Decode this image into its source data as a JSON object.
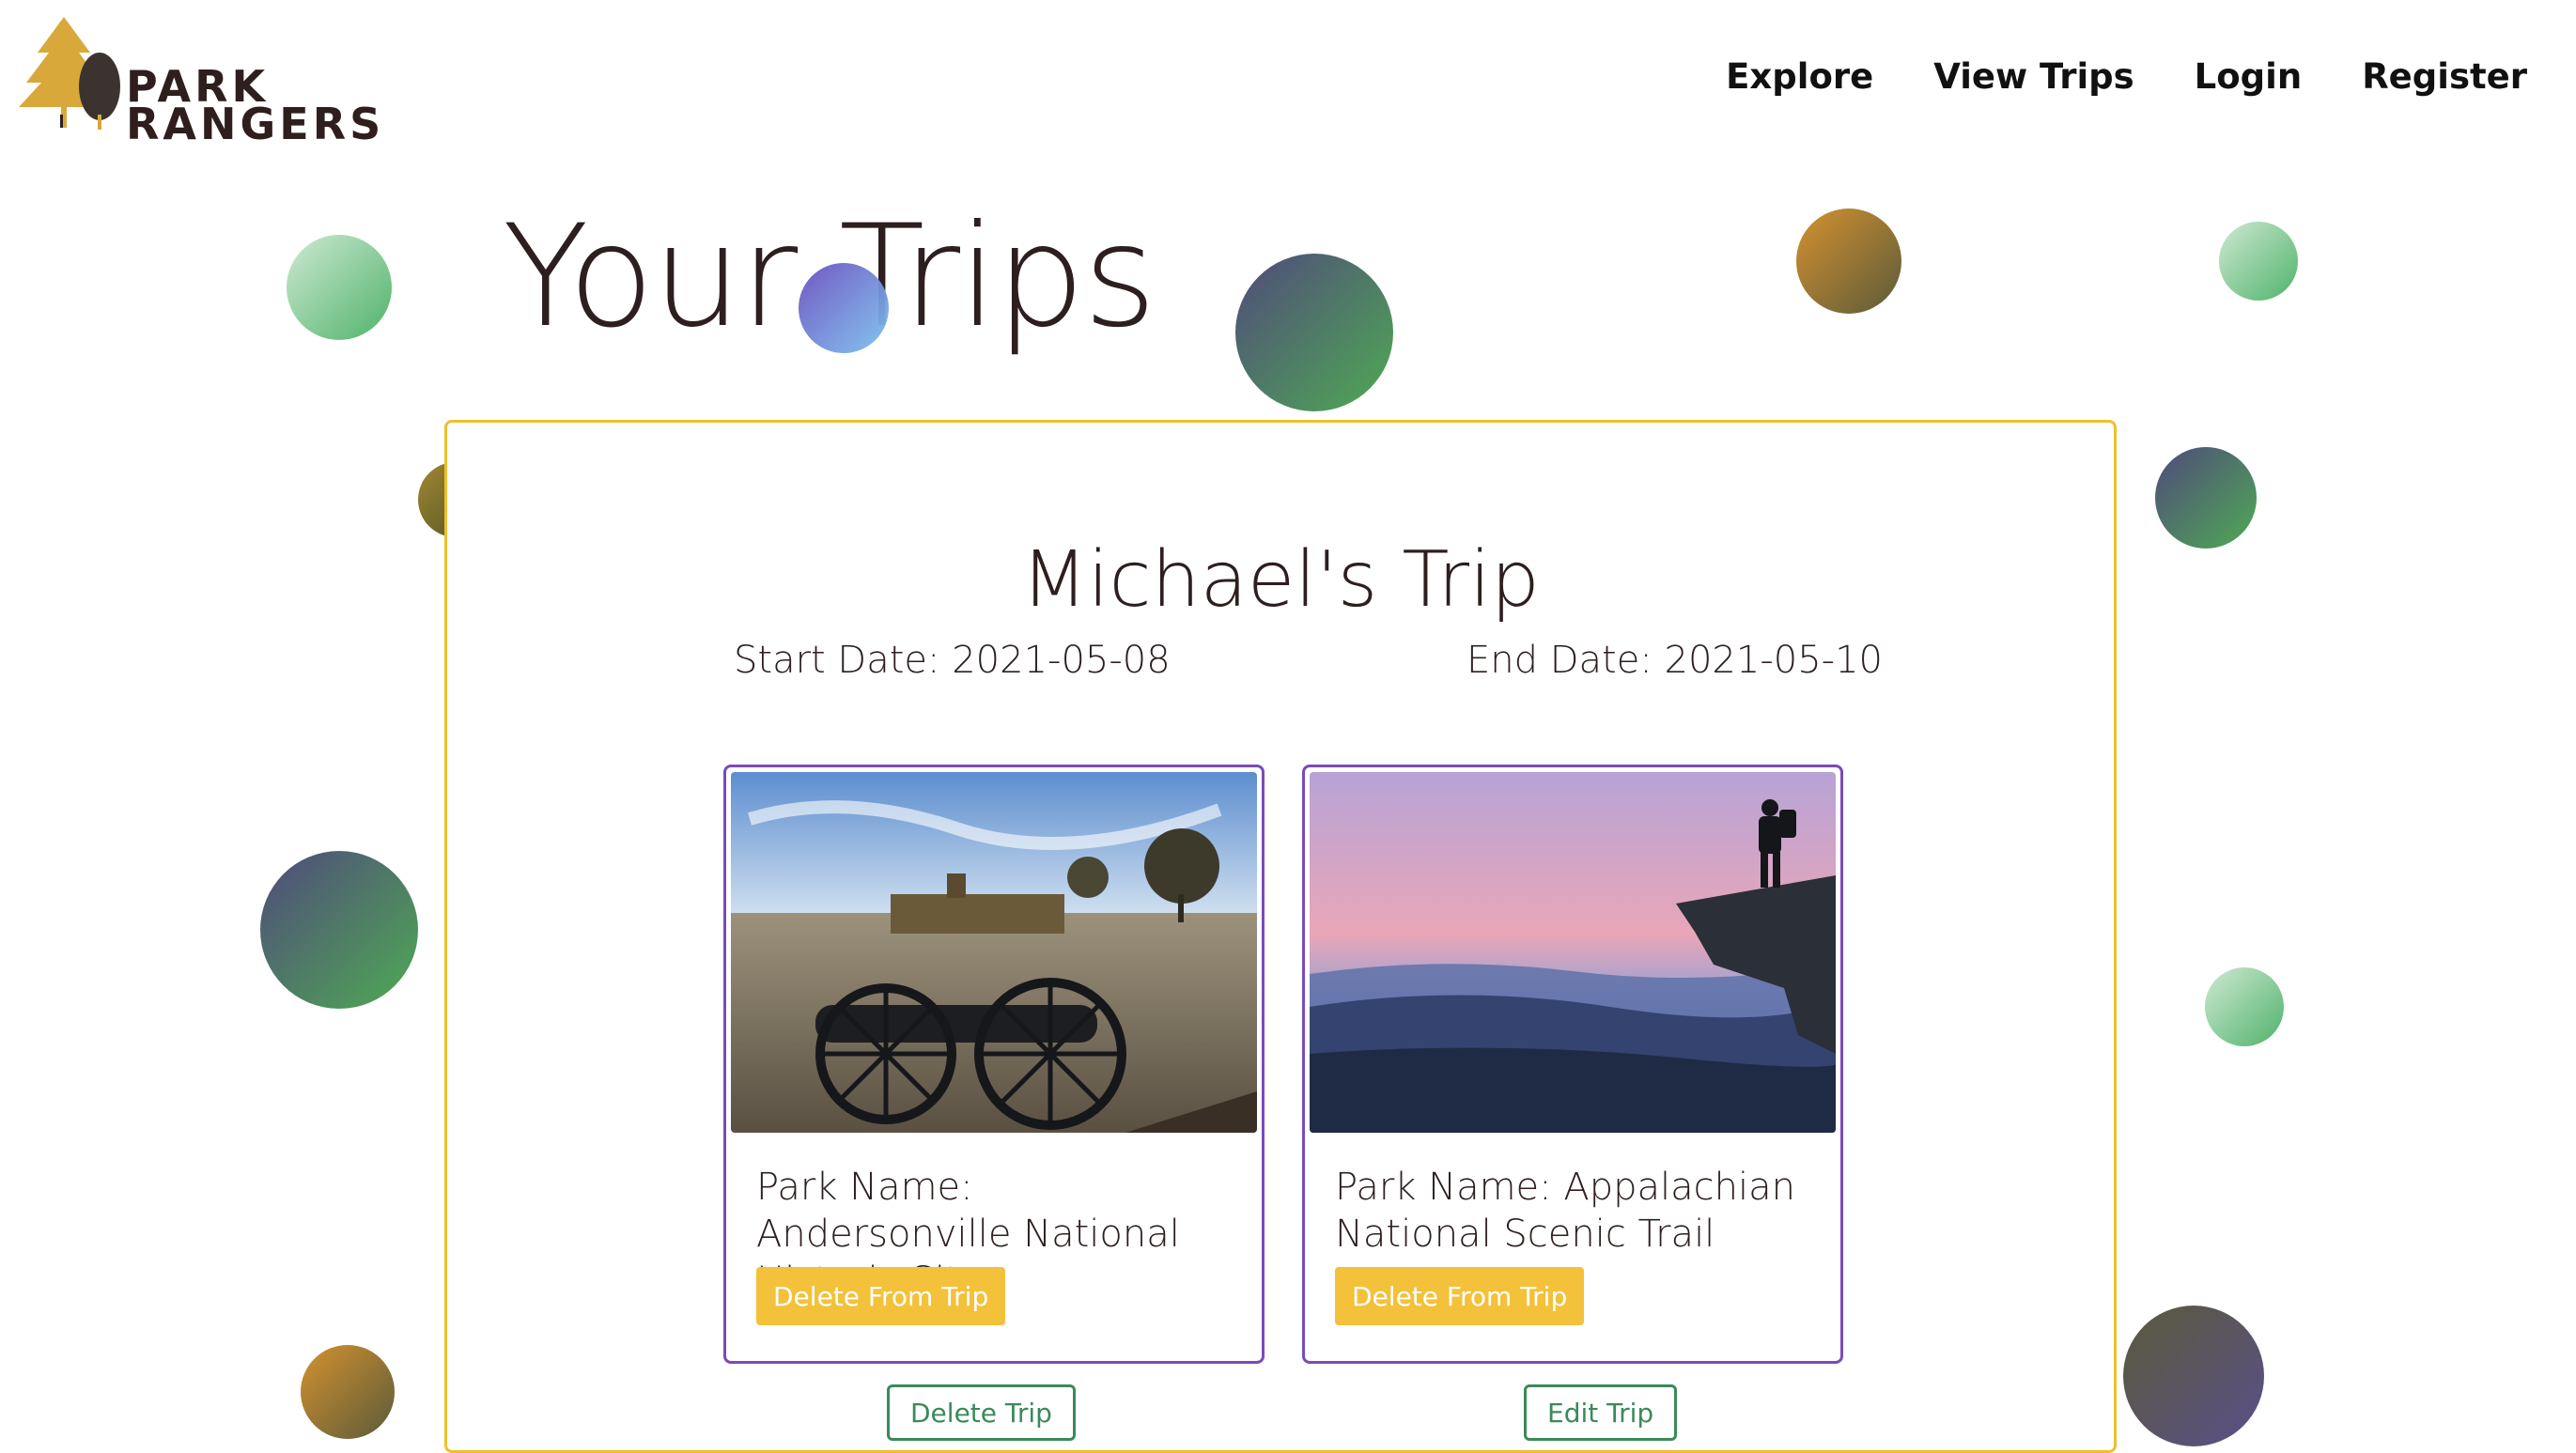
{
  "brand": {
    "line1": "PARK",
    "line2": "RANGERS"
  },
  "nav": [
    "Explore",
    "View Trips",
    "Login",
    "Register"
  ],
  "page_title": "Your Trips",
  "trip": {
    "name": "Michael's Trip",
    "start_date": "Start Date: 2021-05-08",
    "end_date": "End Date: 2021-05-10",
    "parks": [
      {
        "name": "Park Name: Andersonville National Historic Site",
        "photo": "cannon-fort-photo",
        "button": "Delete From Trip"
      },
      {
        "name": "Park Name: Appalachian National Scenic Trail",
        "photo": "hiker-ridge-sunset-photo",
        "button": "Delete From Trip"
      }
    ],
    "footer_buttons": [
      "Delete Trip",
      "Edit Trip"
    ]
  },
  "colors": {
    "accent_yellow": "#f0c02c",
    "card_purple": "#7a4bb8",
    "text_dark": "#2d1f1f",
    "outline_green": "#3a8a5a"
  }
}
